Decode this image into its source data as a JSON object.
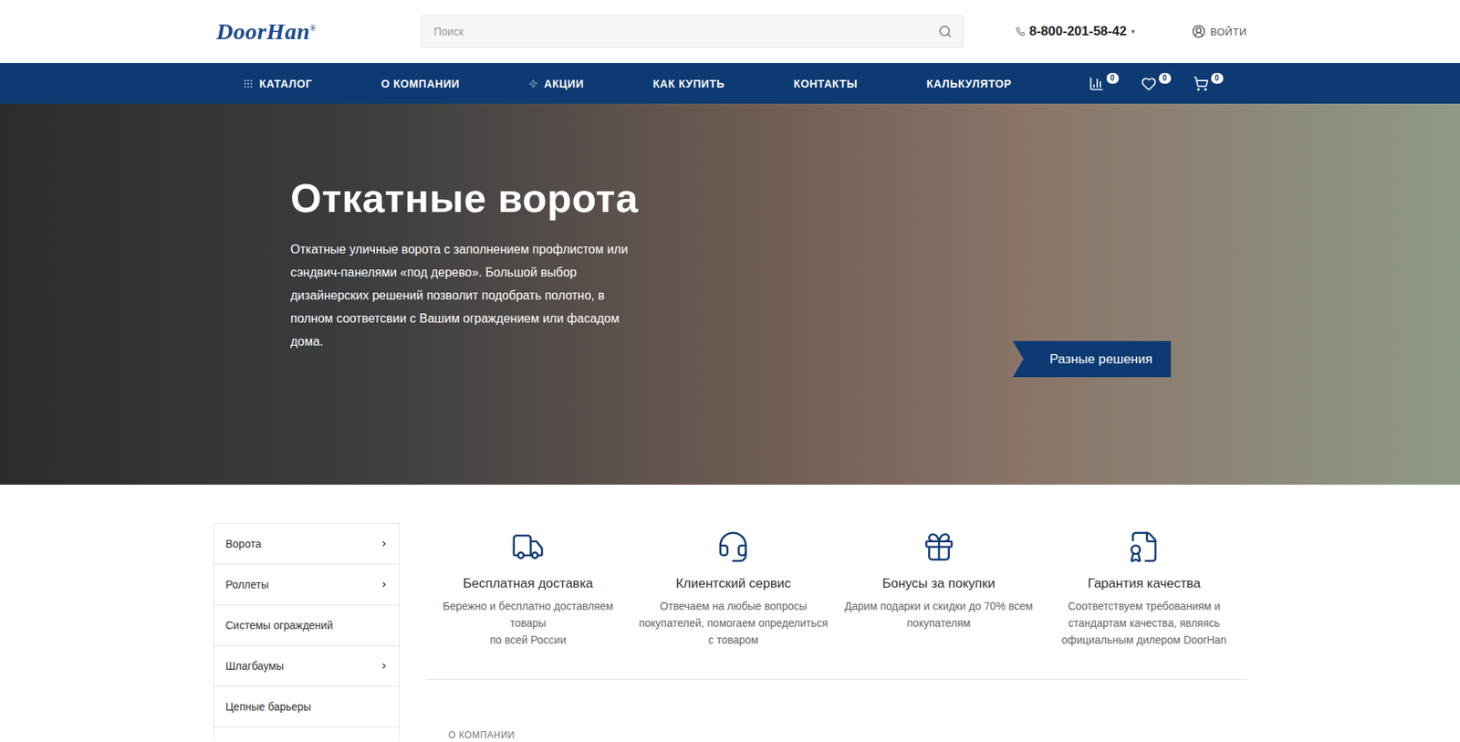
{
  "header": {
    "logo": "DoorHan",
    "logo_mark": "®",
    "search_placeholder": "Поиск",
    "phone": "8-800-201-58-42",
    "phone_caret": "▾",
    "login": "ВОЙТИ"
  },
  "nav": {
    "items": [
      {
        "label": "КАТАЛОГ",
        "icon": "grid"
      },
      {
        "label": "О КОМПАНИИ",
        "icon": "none"
      },
      {
        "label": "АКЦИИ",
        "icon": "bolt"
      },
      {
        "label": "КАК КУПИТЬ",
        "icon": "none"
      },
      {
        "label": "КОНТАКТЫ",
        "icon": "none"
      },
      {
        "label": "КАЛЬКУЛЯТОР",
        "icon": "none"
      }
    ],
    "counters": [
      {
        "kind": "compare",
        "count": "0"
      },
      {
        "kind": "favorites",
        "count": "0"
      },
      {
        "kind": "cart",
        "count": "0"
      }
    ]
  },
  "hero": {
    "title": "Откатные ворота",
    "text": "Откатные уличные ворота с заполнением профлистом или сэндвич-панелями «под дерево». Большой выбор дизайнерских решений позволит подобрать полотно, в полном соответсвии с Вашим ограждением или фасадом дома.",
    "badge": "Разные решения",
    "dots": [
      {
        "selected": true
      },
      {
        "selected": false
      },
      {
        "selected": false
      },
      {
        "selected": false
      },
      {
        "selected": false
      }
    ]
  },
  "sidebar": {
    "items": [
      {
        "label": "Ворота",
        "has_children": true
      },
      {
        "label": "Роллеты",
        "has_children": true
      },
      {
        "label": "Системы ограждений",
        "has_children": false
      },
      {
        "label": "Шлагбаумы",
        "has_children": true
      },
      {
        "label": "Цепные барьеры",
        "has_children": false
      }
    ]
  },
  "features": [
    {
      "kind": "delivery",
      "title": "Бесплатная доставка",
      "lines": [
        "Бережно и бесплатно доставляем товары",
        "по всей России"
      ]
    },
    {
      "kind": "service",
      "title": "Клиентский сервис",
      "lines": [
        "Отвечаем на любые вопросы покупателей, помогаем определиться с товаром"
      ]
    },
    {
      "kind": "bonus",
      "title": "Бонусы за покупки",
      "lines": [
        "Дарим подарки и скидки до 70% всем покупателям"
      ]
    },
    {
      "kind": "quality",
      "title": "Гарантия качества",
      "lines": [
        "Соответствуем требованиям и стандартам качества, являясь официальным дилером DoorHan"
      ]
    }
  ],
  "about": {
    "label": "О КОМПАНИИ"
  }
}
